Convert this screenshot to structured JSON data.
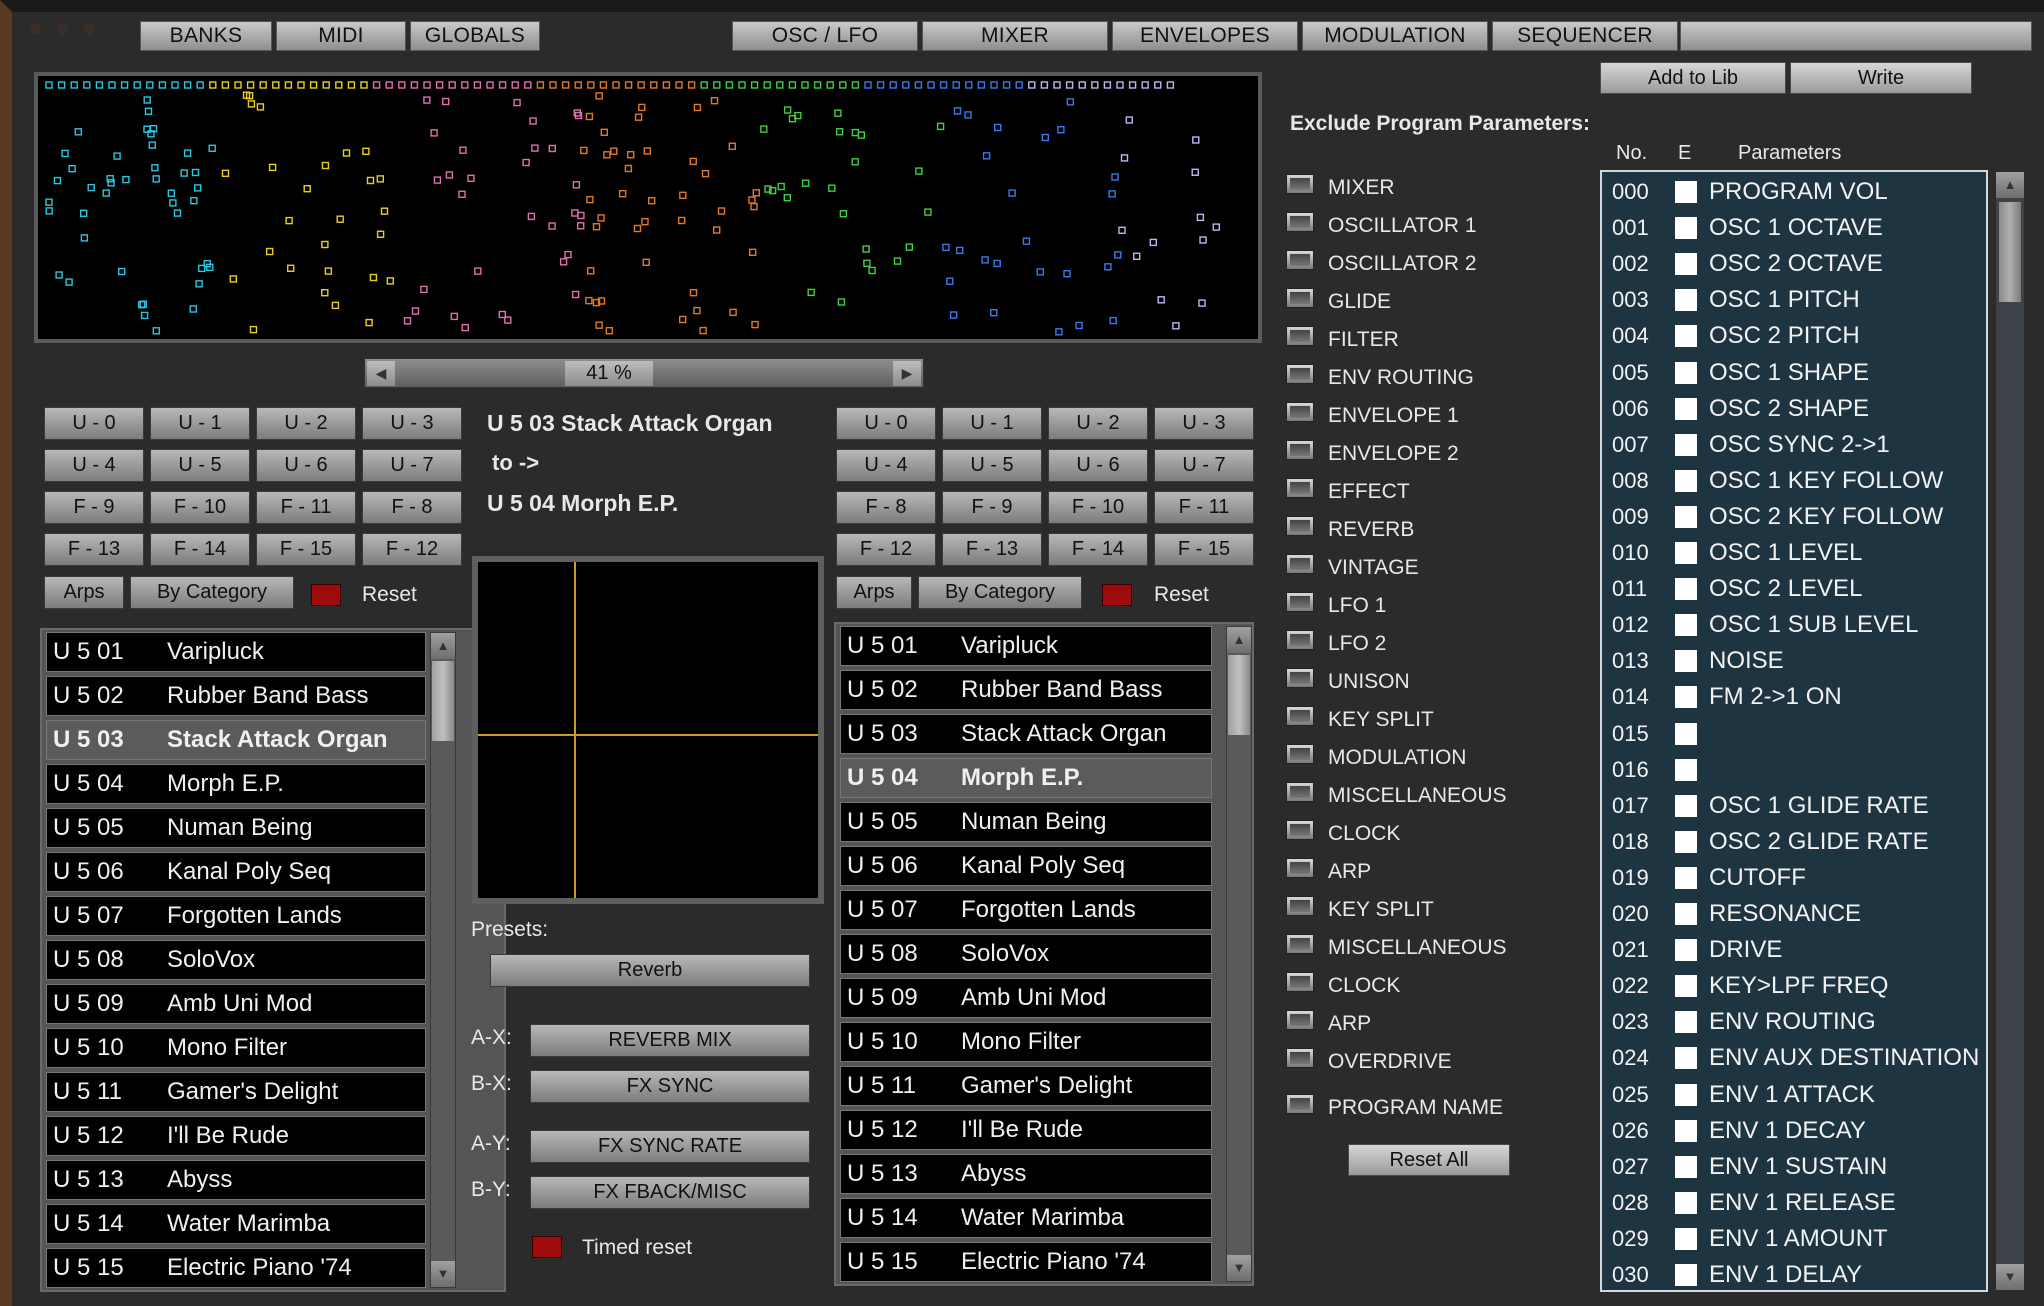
{
  "top_tabs": [
    {
      "label": "BANKS",
      "name": "tab-banks"
    },
    {
      "label": "MIDI",
      "name": "tab-midi"
    },
    {
      "label": "GLOBALS",
      "name": "tab-globals"
    },
    {
      "label": "OSC / LFO",
      "name": "tab-osc-lfo"
    },
    {
      "label": "MIXER",
      "name": "tab-mixer"
    },
    {
      "label": "ENVELOPES",
      "name": "tab-envelopes"
    },
    {
      "label": "MODULATION",
      "name": "tab-modulation"
    },
    {
      "label": "SEQUENCER",
      "name": "tab-sequencer"
    }
  ],
  "actions": {
    "add_to_lib": "Add to Lib",
    "write": "Write"
  },
  "zoom": "41 %",
  "morph": {
    "from": "U 5 03  Stack Attack Organ",
    "to_label": "to ->",
    "to": "U 5 04  Morph E.P."
  },
  "left_bank_buttons": [
    [
      "U - 0",
      "U - 1",
      "U - 2",
      "U - 3"
    ],
    [
      "U - 4",
      "U - 5",
      "U - 6",
      "U - 7"
    ],
    [
      "F - 9",
      "F - 10",
      "F - 11",
      "F - 8"
    ],
    [
      "F - 13",
      "F - 14",
      "F - 15",
      "F - 12"
    ]
  ],
  "right_bank_buttons": [
    [
      "U - 0",
      "U - 1",
      "U - 2",
      "U - 3"
    ],
    [
      "U - 4",
      "U - 5",
      "U - 6",
      "U - 7"
    ],
    [
      "F - 8",
      "F - 9",
      "F - 10",
      "F - 11"
    ],
    [
      "F - 12",
      "F - 13",
      "F - 14",
      "F - 15"
    ]
  ],
  "list_controls": {
    "arps": "Arps",
    "by_category": "By Category",
    "reset": "Reset"
  },
  "programs": [
    {
      "no": "U 5 01",
      "name": "Varipluck"
    },
    {
      "no": "U 5 02",
      "name": "Rubber Band Bass"
    },
    {
      "no": "U 5 03",
      "name": "Stack Attack Organ"
    },
    {
      "no": "U 5 04",
      "name": "Morph E.P."
    },
    {
      "no": "U 5 05",
      "name": "Numan Being"
    },
    {
      "no": "U 5 06",
      "name": "Kanal Poly Seq"
    },
    {
      "no": "U 5 07",
      "name": "Forgotten Lands"
    },
    {
      "no": "U 5 08",
      "name": "SoloVox"
    },
    {
      "no": "U 5 09",
      "name": "Amb Uni Mod"
    },
    {
      "no": "U 5 10",
      "name": "Mono  Filter"
    },
    {
      "no": "U 5 11",
      "name": "Gamer's Delight"
    },
    {
      "no": "U 5 12",
      "name": "I'll Be Rude"
    },
    {
      "no": "U 5 13",
      "name": "Abyss"
    },
    {
      "no": "U 5 14",
      "name": "Water Marimba"
    },
    {
      "no": "U 5 15",
      "name": "Electric Piano '74"
    }
  ],
  "left_selected_index": 2,
  "right_selected_index": 3,
  "presets": {
    "label": "Presets:",
    "value": "Reverb"
  },
  "axes": [
    {
      "label": "A-X:",
      "value": "REVERB MIX"
    },
    {
      "label": "B-X:",
      "value": "FX SYNC"
    },
    {
      "label": "A-Y:",
      "value": "FX SYNC RATE"
    },
    {
      "label": "B-Y:",
      "value": "FX FBACK/MISC"
    }
  ],
  "timed_reset": "Timed reset",
  "exclude": {
    "title": "Exclude Program Parameters:",
    "groups": [
      "MIXER",
      "OSCILLATOR 1",
      "OSCILLATOR 2",
      "GLIDE",
      "FILTER",
      "ENV ROUTING",
      "ENVELOPE 1",
      "ENVELOPE 2",
      "EFFECT",
      "REVERB",
      "VINTAGE",
      "LFO 1",
      "LFO 2",
      "UNISON",
      "KEY SPLIT",
      "MODULATION",
      "MISCELLANEOUS",
      "CLOCK",
      "ARP",
      "KEY SPLIT",
      "MISCELLANEOUS",
      "CLOCK",
      "ARP",
      "OVERDRIVE"
    ],
    "program_name": "PROGRAM NAME",
    "reset_all": "Reset All"
  },
  "param_headers": {
    "no": "No.",
    "e": "E",
    "parameters": "Parameters"
  },
  "parameters": [
    {
      "no": "000",
      "name": "PROGRAM VOL"
    },
    {
      "no": "001",
      "name": "OSC 1 OCTAVE"
    },
    {
      "no": "002",
      "name": "OSC 2 OCTAVE"
    },
    {
      "no": "003",
      "name": "OSC 1 PITCH"
    },
    {
      "no": "004",
      "name": "OSC 2 PITCH"
    },
    {
      "no": "005",
      "name": "OSC 1 SHAPE"
    },
    {
      "no": "006",
      "name": "OSC 2 SHAPE"
    },
    {
      "no": "007",
      "name": "OSC SYNC 2->1"
    },
    {
      "no": "008",
      "name": "OSC 1 KEY FOLLOW"
    },
    {
      "no": "009",
      "name": "OSC 2 KEY FOLLOW"
    },
    {
      "no": "010",
      "name": "OSC 1 LEVEL"
    },
    {
      "no": "011",
      "name": "OSC 2 LEVEL"
    },
    {
      "no": "012",
      "name": "OSC 1 SUB LEVEL"
    },
    {
      "no": "013",
      "name": "NOISE"
    },
    {
      "no": "014",
      "name": "FM 2->1 ON"
    },
    {
      "no": "015",
      "name": ""
    },
    {
      "no": "016",
      "name": ""
    },
    {
      "no": "017",
      "name": "OSC 1 GLIDE RATE"
    },
    {
      "no": "018",
      "name": "OSC 2 GLIDE RATE"
    },
    {
      "no": "019",
      "name": "CUTOFF"
    },
    {
      "no": "020",
      "name": "RESONANCE"
    },
    {
      "no": "021",
      "name": "DRIVE"
    },
    {
      "no": "022",
      "name": "KEY>LPF FREQ"
    },
    {
      "no": "023",
      "name": "ENV ROUTING"
    },
    {
      "no": "024",
      "name": "ENV AUX DESTINATION"
    },
    {
      "no": "025",
      "name": "ENV 1 ATTACK"
    },
    {
      "no": "026",
      "name": "ENV 1 DECAY"
    },
    {
      "no": "027",
      "name": "ENV 1 SUSTAIN"
    },
    {
      "no": "028",
      "name": "ENV 1 RELEASE"
    },
    {
      "no": "029",
      "name": "ENV 1 AMOUNT"
    },
    {
      "no": "030",
      "name": "ENV 1 DELAY"
    }
  ],
  "colors": {
    "cyan": "#28c8e0",
    "yellow": "#e8d020",
    "pink": "#e070b0",
    "orange": "#e07a28",
    "green": "#40d040",
    "blue": "#3a7ae8",
    "lavender": "#b8b8f0",
    "axis": "#c89a2c",
    "record_red": "#9c0c0c"
  }
}
